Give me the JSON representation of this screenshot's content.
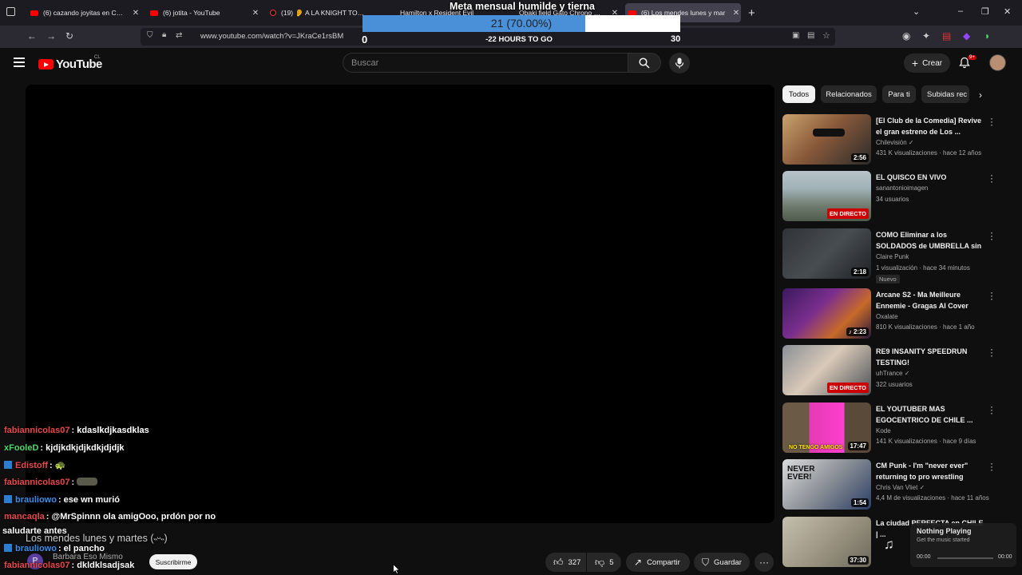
{
  "tabs": [
    {
      "title": "(6) cazando joyitas en Coquimb",
      "favicon": "youtube-icon"
    },
    {
      "title": "(6) jotita - YouTube",
      "favicon": "youtube-icon"
    },
    {
      "title": "(19) 👂 A LA KNIGHT TODO LE",
      "favicon": "tiktok-icon"
    },
    {
      "title": "Hamilton x Resident Evil",
      "favicon": "tab-icon"
    },
    {
      "title": "Obaki field Gato Chrono Resid",
      "favicon": "tab-icon"
    },
    {
      "title": "(6) Los mendes lunes y mar",
      "favicon": "youtube-icon",
      "active": true
    }
  ],
  "browser": {
    "url": "www.youtube.com/watch?v=JKraCe1rsBM"
  },
  "goal": {
    "title": "Meta mensual humilde y tierna",
    "count_label": "21 (70.00%)",
    "progress": 0.7,
    "min": "0",
    "max": "30",
    "time_left": "-22 HOURS TO GO"
  },
  "youtube": {
    "logo_text": "YouTube",
    "country": "CL",
    "search_placeholder": "Buscar",
    "create_label": "Crear",
    "notifications": "9+"
  },
  "chips": [
    "Todos",
    "Relacionados",
    "Para ti",
    "Subidas rec"
  ],
  "recommended": [
    {
      "title": "[El Club de la Comedia] Revive el gran estreno de Los ...",
      "channel": "Chilevisión",
      "verified": true,
      "meta": "431 K visualizaciones · hace 12 años",
      "duration": "2:56"
    },
    {
      "title": "EL QUISCO EN VIVO",
      "channel": "sanantonioimagen",
      "meta": "34 usuarios",
      "live": "EN DIRECTO"
    },
    {
      "title": "COMO Eliminar a los SOLDADOS de UMBRELLA sin ...",
      "channel": "Claire Punk",
      "meta": "1 visualización · hace 34 minutos",
      "duration": "2:18",
      "badge": "Nuevo"
    },
    {
      "title": "Arcane S2 - Ma Meilleure Ennemie - Gragas AI Cover",
      "channel": "Oxalate",
      "meta": "810 K visualizaciones · hace 1 año",
      "duration": "2:23"
    },
    {
      "title": "RE9 INSANITY SPEEDRUN TESTING!",
      "channel": "uhTrance",
      "verified": true,
      "meta": "322 usuarios",
      "live": "EN DIRECTO"
    },
    {
      "title": "EL YOUTUBER MAS EGOCENTRICO DE CHILE ...",
      "channel": "Kode",
      "meta": "141 K visualizaciones · hace 9 días",
      "duration": "17:47",
      "thumb_text": "NO TENGO AMIGOS"
    },
    {
      "title": "CM Punk - I'm \"never ever\" returning to pro wrestling",
      "channel": "Chris Van Vliet",
      "verified": true,
      "meta": "4,4 M de visualizaciones · hace 11 años",
      "duration": "1:54",
      "thumb_text": "NEVER EVER!"
    },
    {
      "title": "La ciudad PERFECTA en CHILE | ...",
      "channel": "",
      "meta": "",
      "duration": "37:30"
    }
  ],
  "chat": [
    {
      "user": "fabiannicolas07",
      "color": "#e8474a",
      "message": ": kdaslkdjkasdklas"
    },
    {
      "user": "xFooleD",
      "color": "#4cd964",
      "message": ": kjdjkdkjdjkdkjdjdjk"
    },
    {
      "user": "Edistoff",
      "color": "#e8474a",
      "message": ": 🐢",
      "badge": true
    },
    {
      "user": "fabiannicolas07",
      "color": "#e8474a",
      "message": ":"
    },
    {
      "user": "brauliowo",
      "color": "#3b8ee8",
      "message": ": ese wn murió",
      "badge": true
    },
    {
      "user": "mancaqla",
      "color": "#e8474a",
      "message": ": @MrSpinnn ola amigOoo, prdón por no"
    },
    {
      "user": "",
      "color": "#fff",
      "message": "saludarte antes"
    },
    {
      "user": "brauliowo",
      "color": "#3b8ee8",
      "message": ": el pancho",
      "badge": true
    },
    {
      "user": "fabiannicolas07",
      "color": "#e8474a",
      "message": ": dkldklsadjsak"
    }
  ],
  "video": {
    "title": "Los mendes lunes y martes (˵ᵕ˵)",
    "channel": "Barbara Eso Mismo",
    "subscribe_label": "Suscribirme",
    "likes": "327",
    "dislikes": "5",
    "share_label": "Compartir",
    "save_label": "Guardar"
  },
  "now_playing": {
    "title": "Nothing Playing",
    "subtitle": "Get the music started",
    "time_start": "00:00",
    "time_end": "00:00"
  }
}
